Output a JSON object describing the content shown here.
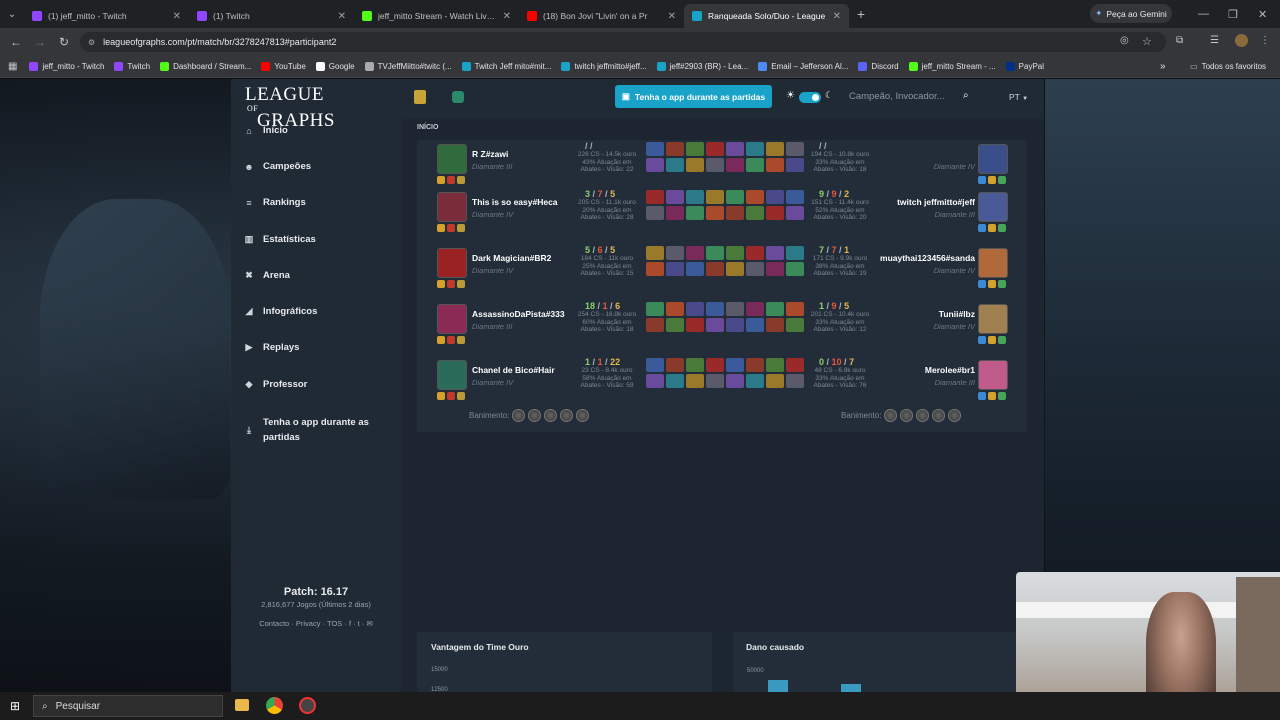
{
  "browser": {
    "tabs": [
      {
        "title": "(1) jeff_mitto - Twitch",
        "favicon_color": "#9146ff",
        "active": false
      },
      {
        "title": "(1) Twitch",
        "favicon_color": "#9146ff",
        "active": false
      },
      {
        "title": "jeff_mitto Stream - Watch Live o",
        "favicon_color": "#53fc18",
        "active": false
      },
      {
        "title": "(18) Bon Jovi \"Livin' on a Pr",
        "favicon_color": "#ff0000",
        "active": false
      },
      {
        "title": "Ranqueada Solo/Duo - League",
        "favicon_color": "#1aa3c9",
        "active": true
      }
    ],
    "gemini_label": "Peça ao Gemini",
    "url": "leagueofgraphs.com/pt/match/br/3278247813#participant2",
    "bookmarks": [
      {
        "label": "jeff_mitto - Twitch",
        "color": "#9146ff"
      },
      {
        "label": "Twitch",
        "color": "#9146ff"
      },
      {
        "label": "Dashboard / Stream...",
        "color": "#53fc18"
      },
      {
        "label": "YouTube",
        "color": "#ff0000"
      },
      {
        "label": "Google",
        "color": "#ffffff"
      },
      {
        "label": "TVJeffMiitto#twitc (...",
        "color": "#aaaaaa"
      },
      {
        "label": "Twitch Jeff mito#mit...",
        "color": "#1aa3c9"
      },
      {
        "label": "twitch jeffmitto#jeff...",
        "color": "#1aa3c9"
      },
      {
        "label": "jeff#2903 (BR) - Lea...",
        "color": "#1aa3c9"
      },
      {
        "label": "Email – Jefferson Al...",
        "color": "#4b8bf5"
      },
      {
        "label": "Discord",
        "color": "#5865f2"
      },
      {
        "label": "jeff_mitto Stream - ...",
        "color": "#53fc18"
      },
      {
        "label": "PayPal",
        "color": "#003087"
      }
    ],
    "all_bookmarks": "Todos os favoritos"
  },
  "site": {
    "logo_line1": "LEAGUE",
    "logo_of": "OF",
    "logo_line2": "GRAPHS",
    "cta_label": "Tenha o app durante as partidas",
    "search_placeholder": "Campeão, Invocador...",
    "lang": "PT",
    "breadcrumb": "INÍCIO",
    "sidebar": [
      {
        "label": "Início",
        "icon": "home-icon"
      },
      {
        "label": "Campeões",
        "icon": "people-icon"
      },
      {
        "label": "Rankings",
        "icon": "list-icon"
      },
      {
        "label": "Estatísticas",
        "icon": "bar-chart-icon"
      },
      {
        "label": "Arena",
        "icon": "crossed-swords-icon"
      },
      {
        "label": "Infográficos",
        "icon": "line-chart-icon"
      },
      {
        "label": "Replays",
        "icon": "play-icon"
      },
      {
        "label": "Professor",
        "icon": "graduation-cap-icon"
      },
      {
        "label": "Tenha o app durante as partidas",
        "icon": "download-icon"
      }
    ],
    "patch_label": "Patch: 16.17",
    "games_label": "2,816,677 Jogos (Últimos 2 dias)",
    "footer_links": "Contacto · Privacy · TOS ·"
  },
  "match": {
    "bans_label": "Banimento:",
    "rows": [
      {
        "left": {
          "name": "R Z#zawi",
          "rank": "Diamante III",
          "k": "",
          "d": "",
          "a": "",
          "stats1": "226 CS - 14.5k ouro",
          "stats2": "43% Atuação em",
          "stats3": "Abates - Visão: 22",
          "color": "#2f6b3c"
        },
        "right": {
          "name": "",
          "rank": "Diamante IV",
          "k": "",
          "d": "",
          "a": "",
          "stats1": "194 CS - 10.8k ouro",
          "stats2": "33% Atuação em",
          "stats3": "Abates - Visão: 18",
          "color": "#3a4f8a"
        }
      },
      {
        "left": {
          "name": "This is so easy#Heca",
          "rank": "Diamante IV",
          "k": "3",
          "d": "7",
          "a": "5",
          "stats1": "205 CS - 11.1k ouro",
          "stats2": "20% Atuação em",
          "stats3": "Abates - Visão: 28",
          "color": "#7b2c3a"
        },
        "right": {
          "name": "twitch jeffmitto#jeff",
          "rank": "Diamante III",
          "k": "9",
          "d": "9",
          "a": "2",
          "stats1": "151 CS - 11.4k ouro",
          "stats2": "52% Atuação em",
          "stats3": "Abates - Visão: 20",
          "color": "#4a5a96"
        }
      },
      {
        "left": {
          "name": "Dark Magician#BR2",
          "rank": "Diamante IV",
          "k": "5",
          "d": "6",
          "a": "5",
          "stats1": "184 CS - 11k ouro",
          "stats2": "25% Atuação em",
          "stats3": "Abates - Visão: 15",
          "color": "#9b2222"
        },
        "right": {
          "name": "muaythai123456#sanda",
          "rank": "Diamante IV",
          "k": "7",
          "d": "7",
          "a": "1",
          "stats1": "171 CS - 9.9k ouro",
          "stats2": "38% Atuação em",
          "stats3": "Abates - Visão: 19",
          "color": "#b06a3a"
        }
      },
      {
        "left": {
          "name": "AssassinoDaPista#333",
          "rank": "Diamante III",
          "k": "18",
          "d": "1",
          "a": "6",
          "stats1": "254 CS - 16.8k ouro",
          "stats2": "60% Atuação em",
          "stats3": "Abates - Visão: 18",
          "color": "#8a2a55"
        },
        "right": {
          "name": "Tunii#lbz",
          "rank": "Diamante IV",
          "k": "1",
          "d": "9",
          "a": "5",
          "stats1": "201 CS - 10.4k ouro",
          "stats2": "33% Atuação em",
          "stats3": "Abates - Visão: 12",
          "color": "#a08050"
        }
      },
      {
        "left": {
          "name": "Chanel de Bico#Hair",
          "rank": "Diamante IV",
          "k": "1",
          "d": "1",
          "a": "22",
          "stats1": "23 CS - 8.4k ouro",
          "stats2": "58% Atuação em",
          "stats3": "Abates - Visão: 59",
          "color": "#2a6b5a"
        },
        "right": {
          "name": "Merolee#br1",
          "rank": "Diamante III",
          "k": "0",
          "d": "10",
          "a": "7",
          "stats1": "48 CS - 6.9k ouro",
          "stats2": "33% Atuação em",
          "stats3": "Abates - Visão: 76",
          "color": "#c05a8a"
        }
      }
    ]
  },
  "panels": {
    "left_title": "Vantagem do Time Ouro",
    "left_tick1": "15000",
    "left_tick2": "12500",
    "right_title": "Dano causado",
    "right_tick1": "50000"
  },
  "taskbar": {
    "search_label": "Pesquisar"
  }
}
